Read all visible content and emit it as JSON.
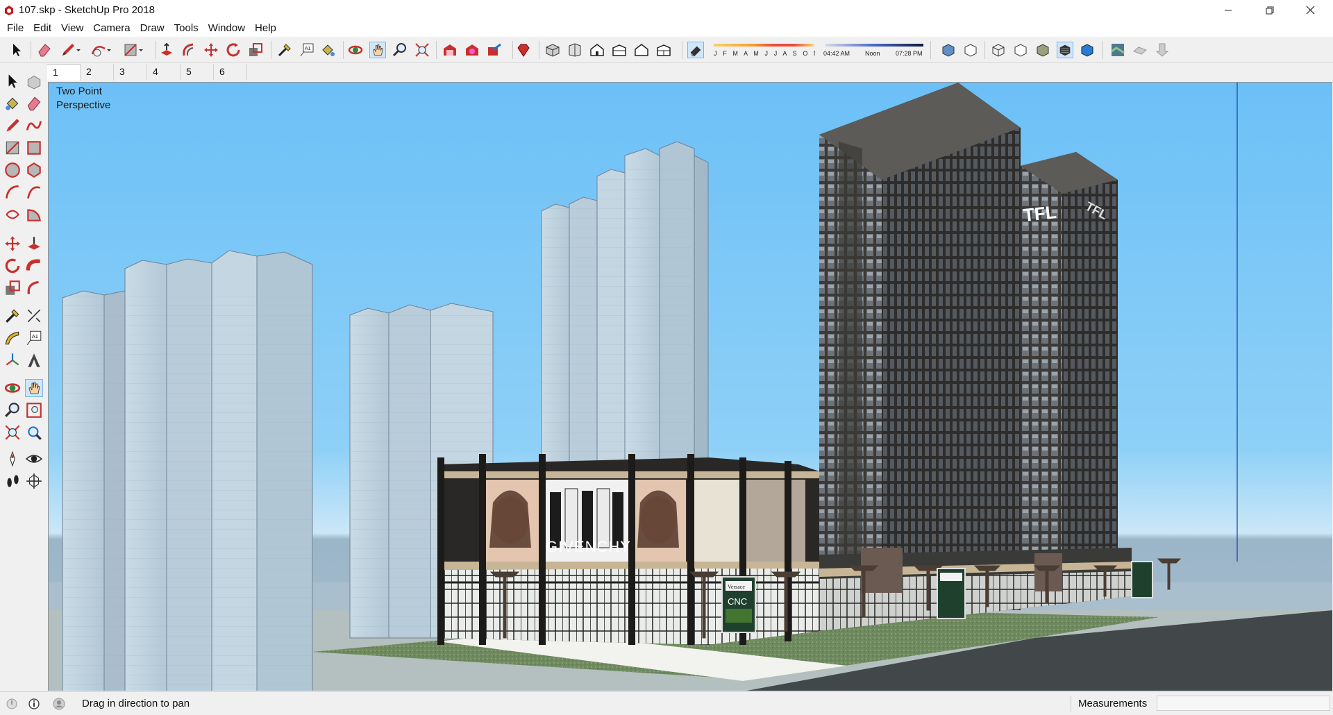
{
  "window": {
    "title": "107.skp - SketchUp Pro 2018",
    "minimize_icon": "minimize-icon",
    "maximize_icon": "restore-icon",
    "close_icon": "close-icon"
  },
  "menu": [
    "File",
    "Edit",
    "View",
    "Camera",
    "Draw",
    "Tools",
    "Window",
    "Help"
  ],
  "toolbar": {
    "shadow_months": "J F M A M J J A S O N D",
    "time_start": "04:42 AM",
    "time_noon": "Noon",
    "time_end": "07:28 PM"
  },
  "scene_tabs": [
    "1",
    "2",
    "3",
    "4",
    "5",
    "6"
  ],
  "active_scene": "1",
  "viewport": {
    "camera_label_line1": "Two Point",
    "camera_label_line2": "Perspective",
    "sky_color": "#7ac6f7",
    "signage": {
      "billboard_brand": "GIVENCHY",
      "tower_logo": "TFL",
      "tower_logo_side": "TFL",
      "kiosk_brand": "CNC",
      "kiosk_top": "Versace"
    }
  },
  "status": {
    "hint": "Drag in direction to pan",
    "measurements_label": "Measurements",
    "measurements_value": ""
  },
  "colors": {
    "accent_active_tool": "#cfe6fb",
    "brand_red": "#c41a1a"
  }
}
